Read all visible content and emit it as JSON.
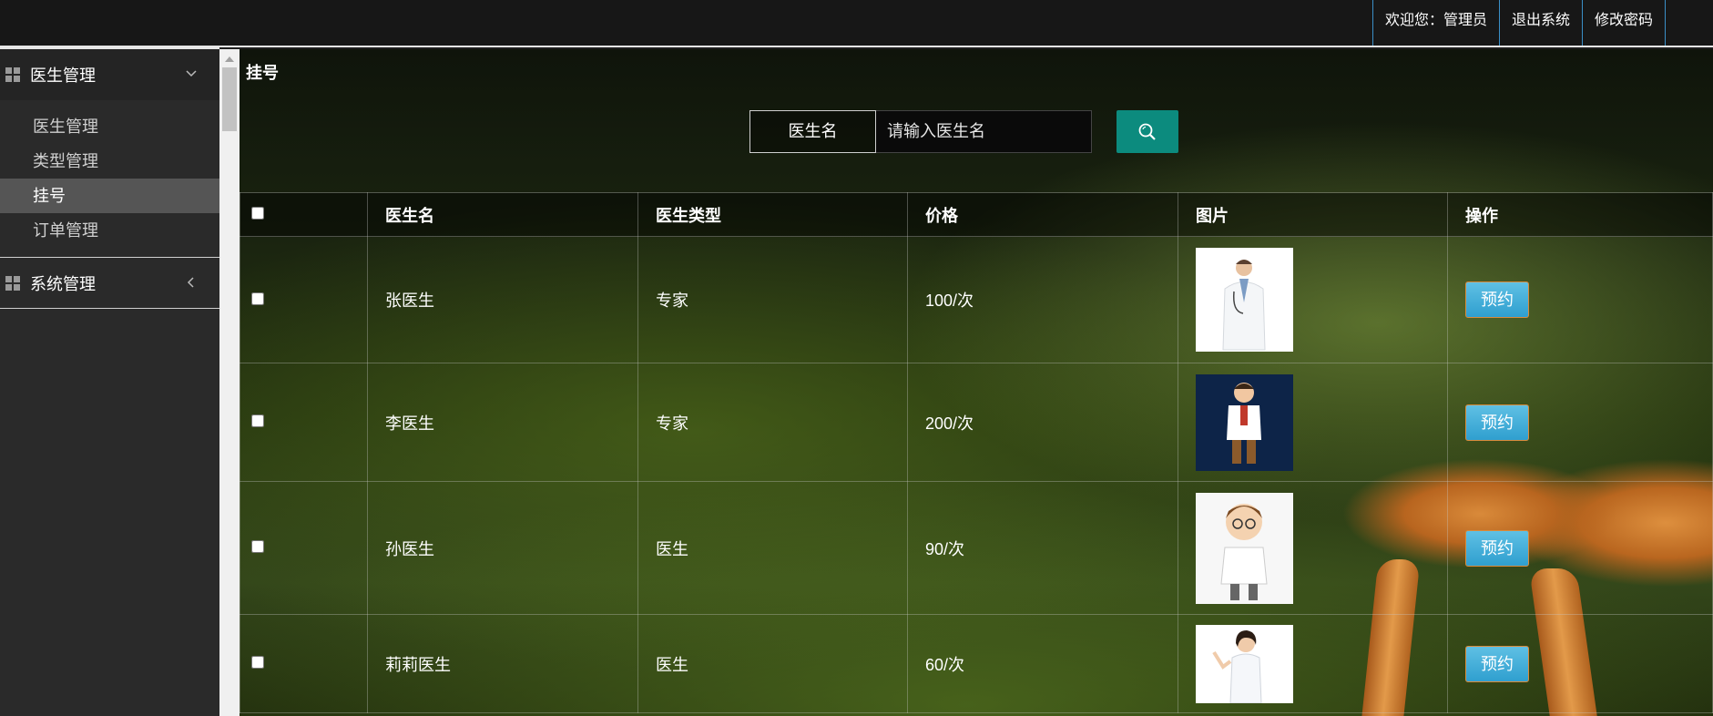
{
  "topbar": {
    "welcome": "欢迎您：管理员",
    "logout": "退出系统",
    "change_password": "修改密码"
  },
  "sidebar": {
    "menu1": {
      "label": "医生管理",
      "items": [
        "医生管理",
        "类型管理",
        "挂号",
        "订单管理"
      ],
      "active": "挂号"
    },
    "menu2": {
      "label": "系统管理"
    }
  },
  "main": {
    "title": "挂号",
    "search": {
      "label": "医生名",
      "placeholder": "请输入医生名"
    },
    "table": {
      "headers": [
        "医生名",
        "医生类型",
        "价格",
        "图片",
        "操作"
      ],
      "rows": [
        {
          "name": "张医生",
          "type": "专家",
          "price": "100/次",
          "action": "预约"
        },
        {
          "name": "李医生",
          "type": "专家",
          "price": "200/次",
          "action": "预约"
        },
        {
          "name": "孙医生",
          "type": "医生",
          "price": "90/次",
          "action": "预约"
        },
        {
          "name": "莉莉医生",
          "type": "医生",
          "price": "60/次",
          "action": "预约"
        }
      ]
    }
  },
  "colors": {
    "accent": "#0c8b7e",
    "button": "#3aa8d6",
    "sidebar_bg": "#2a2a2a",
    "topbar_bg": "#171717"
  }
}
